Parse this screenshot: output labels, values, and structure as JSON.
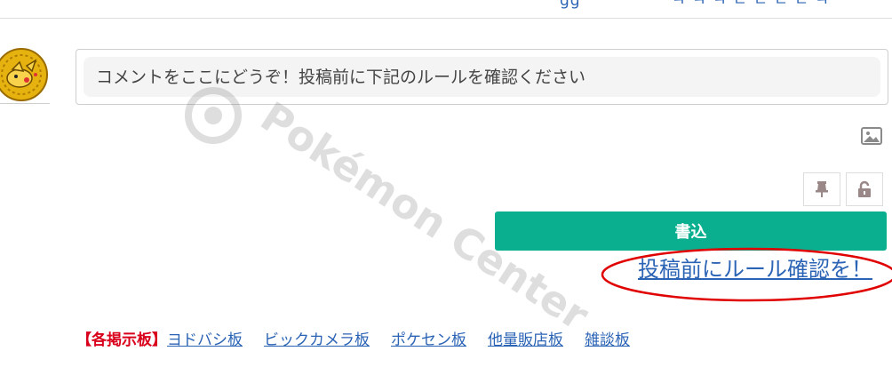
{
  "comment": {
    "placeholder": "コメントをここにどうぞ！投稿前に下記のルールを確認ください",
    "value": ""
  },
  "toolbar": {
    "image_icon": "image-icon",
    "pin_icon": "pin-icon",
    "lock_icon": "unlock-icon"
  },
  "submit": {
    "label": "書込"
  },
  "rules_link": {
    "label": "投稿前にルール確認を！"
  },
  "annotation": {
    "color": "#e00000"
  },
  "watermark": {
    "text": "Pokémon Center"
  },
  "boards": {
    "label": "【各掲示板】",
    "links": [
      "ヨドバシ板",
      "ビックカメラ板",
      "ポケセン板",
      "他量販店板",
      "雑談板"
    ]
  },
  "colors": {
    "accent": "#0aaf8f",
    "link": "#2b63b5",
    "board_label": "#d9001b"
  }
}
